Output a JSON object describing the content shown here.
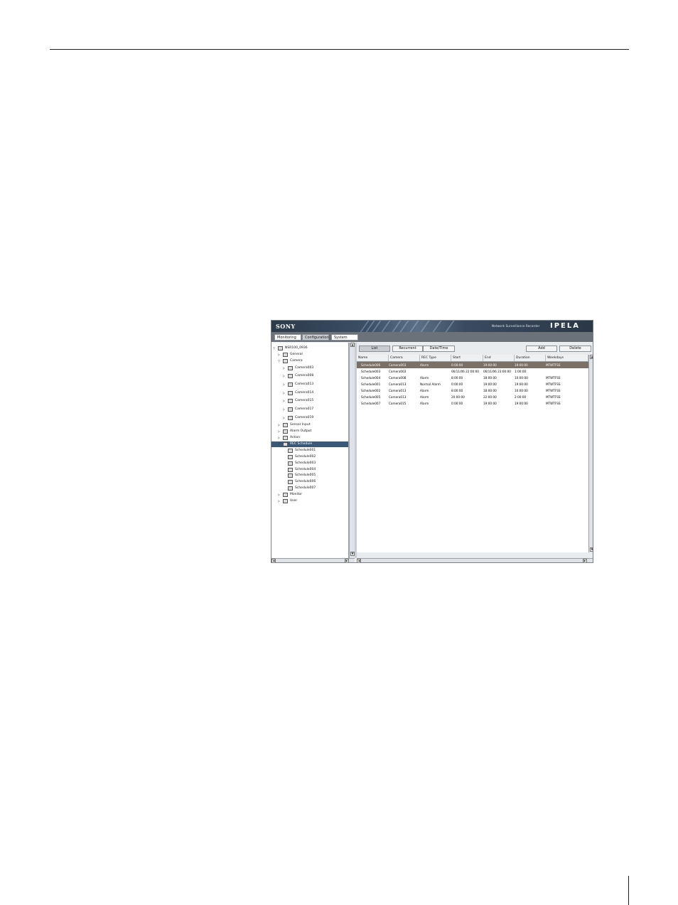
{
  "header": {
    "brand": "SONY",
    "product": "Network Surveillance Recorder",
    "logo": "IPELA"
  },
  "tabs": [
    {
      "label": "Monitoring",
      "active": false
    },
    {
      "label": "Configuration",
      "active": true
    },
    {
      "label": "System",
      "active": false
    }
  ],
  "tree": [
    {
      "label": "NSR100_0936",
      "toggle": "▽",
      "icon": "recorder-icon"
    },
    {
      "label": "General",
      "toggle": "▷",
      "icon": "general-icon"
    },
    {
      "label": "Camera",
      "toggle": "▽",
      "icon": "camera-group-icon"
    },
    {
      "label": "Camera003",
      "toggle": "▷",
      "icon": "camera-icon"
    },
    {
      "label": "Camera008",
      "toggle": "▷",
      "icon": "camera-icon"
    },
    {
      "label": "Camera013",
      "toggle": "▷",
      "icon": "camera-icon"
    },
    {
      "label": "Camera014",
      "toggle": "▷",
      "icon": "camera-icon"
    },
    {
      "label": "Camera015",
      "toggle": "▷",
      "icon": "camera-icon"
    },
    {
      "label": "Camera017",
      "toggle": "▷",
      "icon": "camera-icon"
    },
    {
      "label": "Camera019",
      "toggle": "▷",
      "icon": "camera-icon"
    },
    {
      "label": "Sensor Input",
      "toggle": "▷",
      "icon": "sensor-input-icon"
    },
    {
      "label": "Alarm Output",
      "toggle": "▷",
      "icon": "alarm-output-icon"
    },
    {
      "label": "Action",
      "toggle": "▷",
      "icon": "action-icon"
    },
    {
      "label": "REC Schedule",
      "toggle": "▽",
      "icon": "rec-schedule-icon",
      "selected": true
    },
    {
      "label": "Schedule001",
      "toggle": "",
      "icon": "schedule-icon"
    },
    {
      "label": "Schedule002",
      "toggle": "",
      "icon": "schedule-icon"
    },
    {
      "label": "Schedule003",
      "toggle": "",
      "icon": "schedule-icon"
    },
    {
      "label": "Schedule004",
      "toggle": "",
      "icon": "schedule-icon"
    },
    {
      "label": "Schedule005",
      "toggle": "",
      "icon": "schedule-icon"
    },
    {
      "label": "Schedule006",
      "toggle": "",
      "icon": "schedule-icon"
    },
    {
      "label": "Schedule007",
      "toggle": "",
      "icon": "schedule-icon"
    },
    {
      "label": "Monitor",
      "toggle": "▷",
      "icon": "monitor-icon"
    },
    {
      "label": "User",
      "toggle": "▷",
      "icon": "user-icon"
    }
  ],
  "toolbar": {
    "list": "List",
    "recurrent": "Recurrent",
    "datetime": "Date/Time",
    "add": "Add",
    "delete": "Delete"
  },
  "table": {
    "columns": [
      "Name",
      "Camera",
      "REC Type",
      "Start",
      "End",
      "Duration",
      "Weekdays"
    ],
    "rows": [
      [
        "Schedule006",
        "Camera003",
        "Alarm",
        "0:00:00",
        "19:00:00",
        "19:00:00",
        "MTWTFSS"
      ],
      [
        "Schedule003",
        "Camera003",
        "",
        "06/11/06 22:00:00",
        "06/11/06 23:00:00",
        "1:00:00",
        ""
      ],
      [
        "Schedule004",
        "Camera008",
        "Alarm",
        "8:00:00",
        "18:00:00",
        "10:00:00",
        "MTWTFSS"
      ],
      [
        "Schedule001",
        "Camera013",
        "Normal Alarm",
        "0:00:00",
        "19:00:00",
        "19:00:00",
        "MTWTFSS"
      ],
      [
        "Schedule002",
        "Camera013",
        "Alarm",
        "8:00:00",
        "18:00:00",
        "10:00:00",
        "MTWTFSS"
      ],
      [
        "Schedule005",
        "Camera013",
        "Alarm",
        "20:00:00",
        "22:00:00",
        "2:00:00",
        "MTWTFSS"
      ],
      [
        "Schedule007",
        "Camera015",
        "Alarm",
        "0:00:00",
        "19:00:00",
        "19:00:00",
        "MTWTFSS"
      ]
    ],
    "selected_row": 0
  },
  "colors": {
    "banner": "#2c3a4a",
    "tab_bar": "#6c727a",
    "selected_tree": "#3b5876",
    "selected_row": "#7b7068"
  }
}
